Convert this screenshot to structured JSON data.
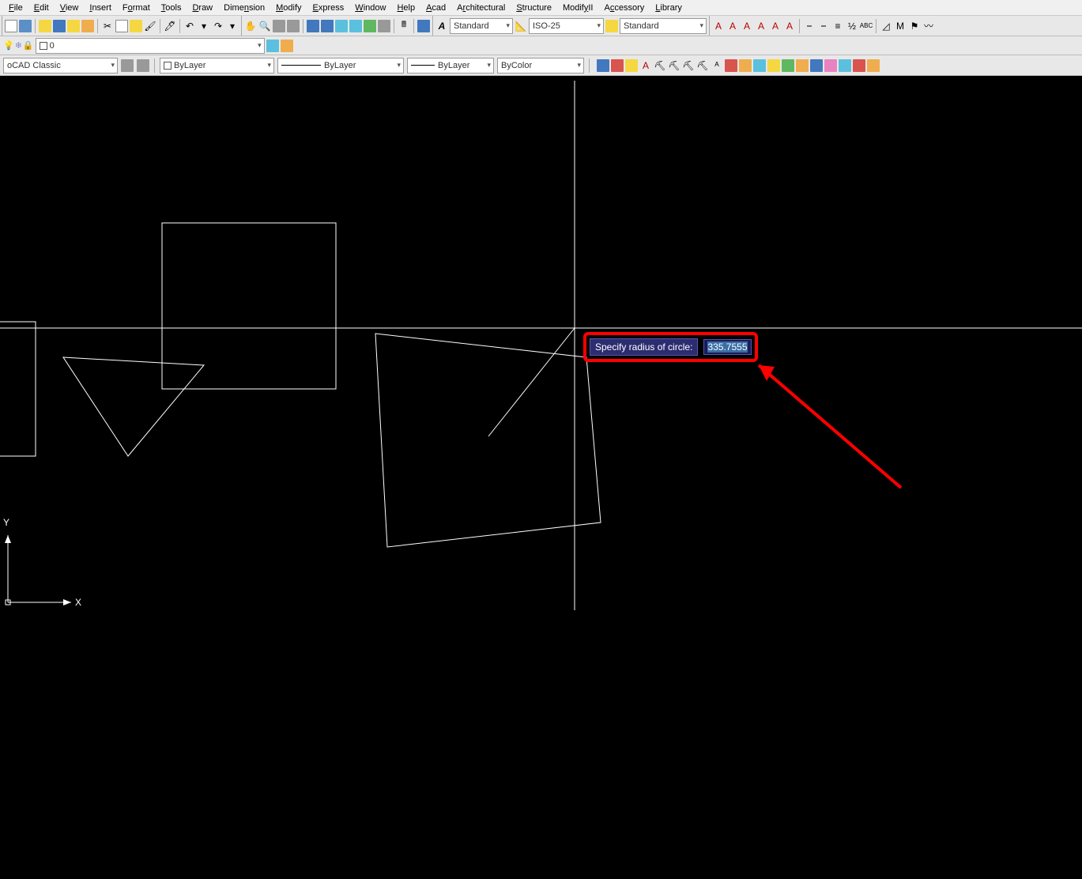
{
  "menu": [
    "File",
    "Edit",
    "View",
    "Insert",
    "Format",
    "Tools",
    "Draw",
    "Dimension",
    "Modify",
    "Express",
    "Window",
    "Help",
    "Acad",
    "Architectural",
    "Structure",
    "ModifyII",
    "Accessory",
    "Library"
  ],
  "menu_underline_idx": [
    0,
    0,
    0,
    0,
    2,
    0,
    0,
    6,
    0,
    0,
    0,
    0,
    0,
    1,
    0,
    6,
    1,
    0
  ],
  "layer_combo": "0",
  "workspace": "oCAD Classic",
  "color_combo": "ByLayer",
  "linetype_combo": "ByLayer",
  "lineweight_combo": "ByLayer",
  "plotstyle_combo": "ByColor",
  "textstyle_combo": "Standard",
  "dimstyle_combo": "ISO-25",
  "tablestyle_combo": "Standard",
  "prompt": {
    "label": "Specify radius of circle:",
    "value": "335.7555"
  },
  "ucs": {
    "x_label": "X",
    "y_label": "Y"
  }
}
